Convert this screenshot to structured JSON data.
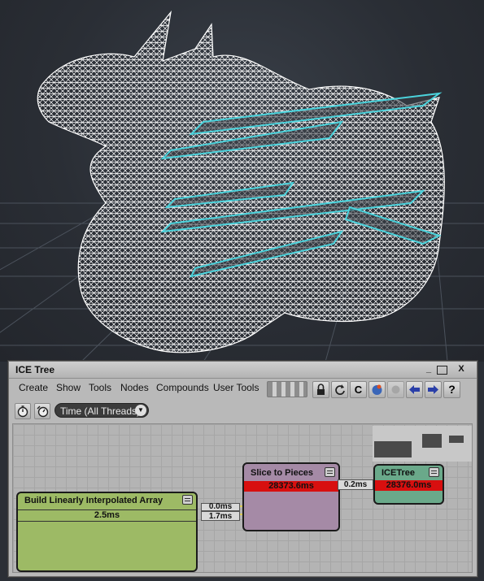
{
  "window": {
    "title": "ICE Tree",
    "controls": {
      "minimize": "_",
      "maximize": "□",
      "close": "X"
    }
  },
  "menu": {
    "items": [
      "Create",
      "Show",
      "Tools",
      "Nodes",
      "Compounds",
      "User Tools"
    ]
  },
  "toolbar": {
    "icons": [
      "lock-icon",
      "refresh-icon",
      "compound-c-icon",
      "sphere-icon",
      "disabled-circle-icon",
      "back-arrow-icon",
      "forward-arrow-icon",
      "help-icon"
    ],
    "help_label": "?",
    "compound_label": "C"
  },
  "timing": {
    "mode_label": "Time (All Threads)"
  },
  "nodes": {
    "build": {
      "title": "Build Linearly Interpolated Array",
      "time": "2.5ms"
    },
    "slice": {
      "title": "Slice to Pieces",
      "time": "28373.6ms"
    },
    "icetree": {
      "title": "ICETree",
      "time": "28376.0ms"
    }
  },
  "connections": {
    "build_to_slice_top": "0.0ms",
    "build_to_slice_bottom": "1.7ms",
    "slice_to_icetree": "0.2ms"
  },
  "colors": {
    "build_node": "#9dba65",
    "slice_node": "#a58aa6",
    "icetree_node": "#6aa98a",
    "time_bar_red": "#d80f0f",
    "slice_plane": "#4bd3dc"
  }
}
